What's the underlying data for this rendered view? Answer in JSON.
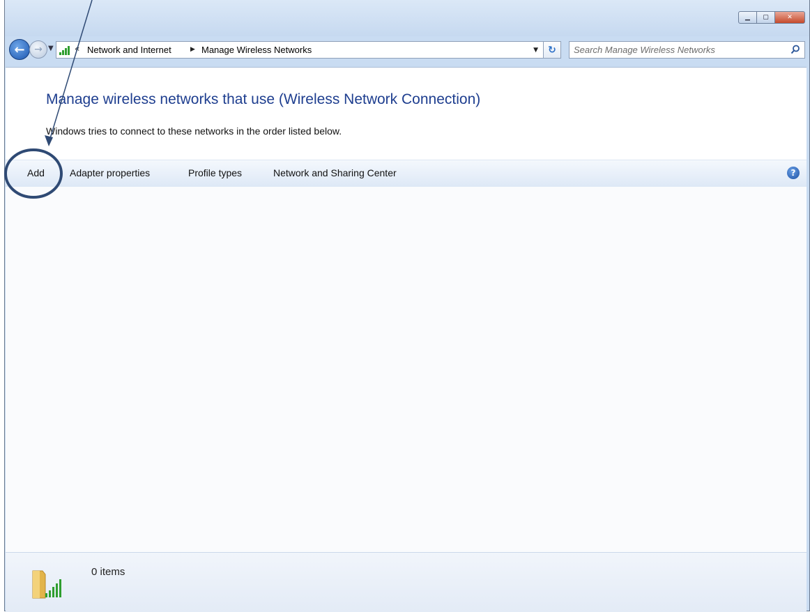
{
  "window": {
    "caption_buttons": [
      {
        "name": "minimize",
        "glyph": "▁"
      },
      {
        "name": "maximize",
        "glyph": "▢"
      },
      {
        "name": "close",
        "glyph": "✕"
      }
    ]
  },
  "nav": {
    "back_glyph": "←",
    "forward_glyph": "→",
    "recent_glyph": "▼",
    "overflow_glyph": "«",
    "breadcrumbs": [
      "Network and Internet",
      "Manage Wireless Networks"
    ],
    "crumb_separator": "▶",
    "dropdown_glyph": "▼",
    "refresh_glyph": "↻",
    "search_placeholder": "Search Manage Wireless Networks"
  },
  "main": {
    "heading": "Manage wireless networks that use (Wireless Network Connection)",
    "subtext": "Windows tries to connect to these networks in the order listed below."
  },
  "toolbar": {
    "add_label": "Add",
    "adapter_label": "Adapter properties",
    "profile_label": "Profile types",
    "sharing_label": "Network and Sharing Center",
    "help_glyph": "?"
  },
  "status": {
    "item_count": "0 items"
  },
  "colors": {
    "heading": "#1e3e8f",
    "annotation": "#2f4a74",
    "signal_green": "#2f9e2f"
  },
  "icons": [
    "back-arrow-icon",
    "forward-arrow-icon",
    "network-signal-icon",
    "refresh-icon",
    "search-icon",
    "help-icon",
    "folder-signal-icon"
  ]
}
